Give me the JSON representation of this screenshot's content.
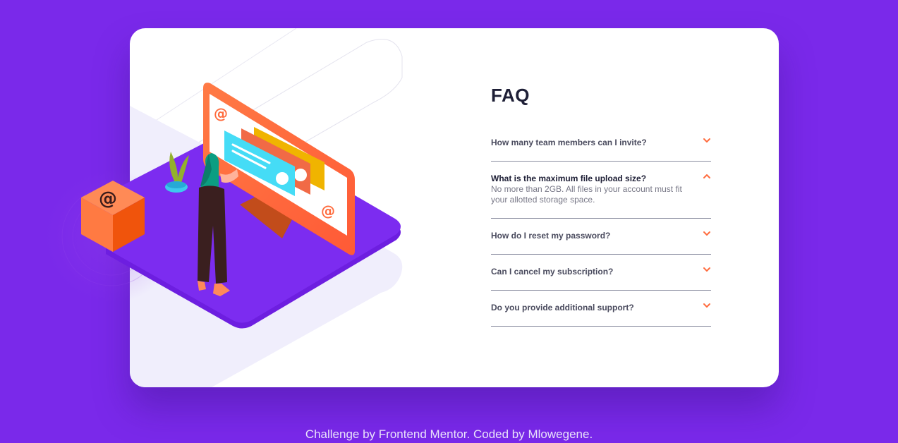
{
  "faq": {
    "title": "FAQ",
    "items": [
      {
        "question": "How many team members can I invite?",
        "answer": "",
        "open": false
      },
      {
        "question": "What is the maximum file upload size?",
        "answer": "No more than 2GB. All files in your account must fit your allotted storage space.",
        "open": true
      },
      {
        "question": "How do I reset my password?",
        "answer": "",
        "open": false
      },
      {
        "question": "Can I cancel my subscription?",
        "answer": "",
        "open": false
      },
      {
        "question": "Do you provide additional support?",
        "answer": "",
        "open": false
      }
    ]
  },
  "footer": {
    "prefix": "Challenge by ",
    "link1": "Frontend Mentor",
    "middle": ". Coded by ",
    "link2": "Mlowegene",
    "suffix": "."
  },
  "colors": {
    "background": "#7a29ea",
    "card": "#ffffff",
    "accent": "#ff6b3d",
    "heading": "#1e1f36",
    "text": "#4a4b5e"
  },
  "icons": {
    "chevron_down": "chevron-down-icon",
    "chevron_up": "chevron-up-icon"
  }
}
